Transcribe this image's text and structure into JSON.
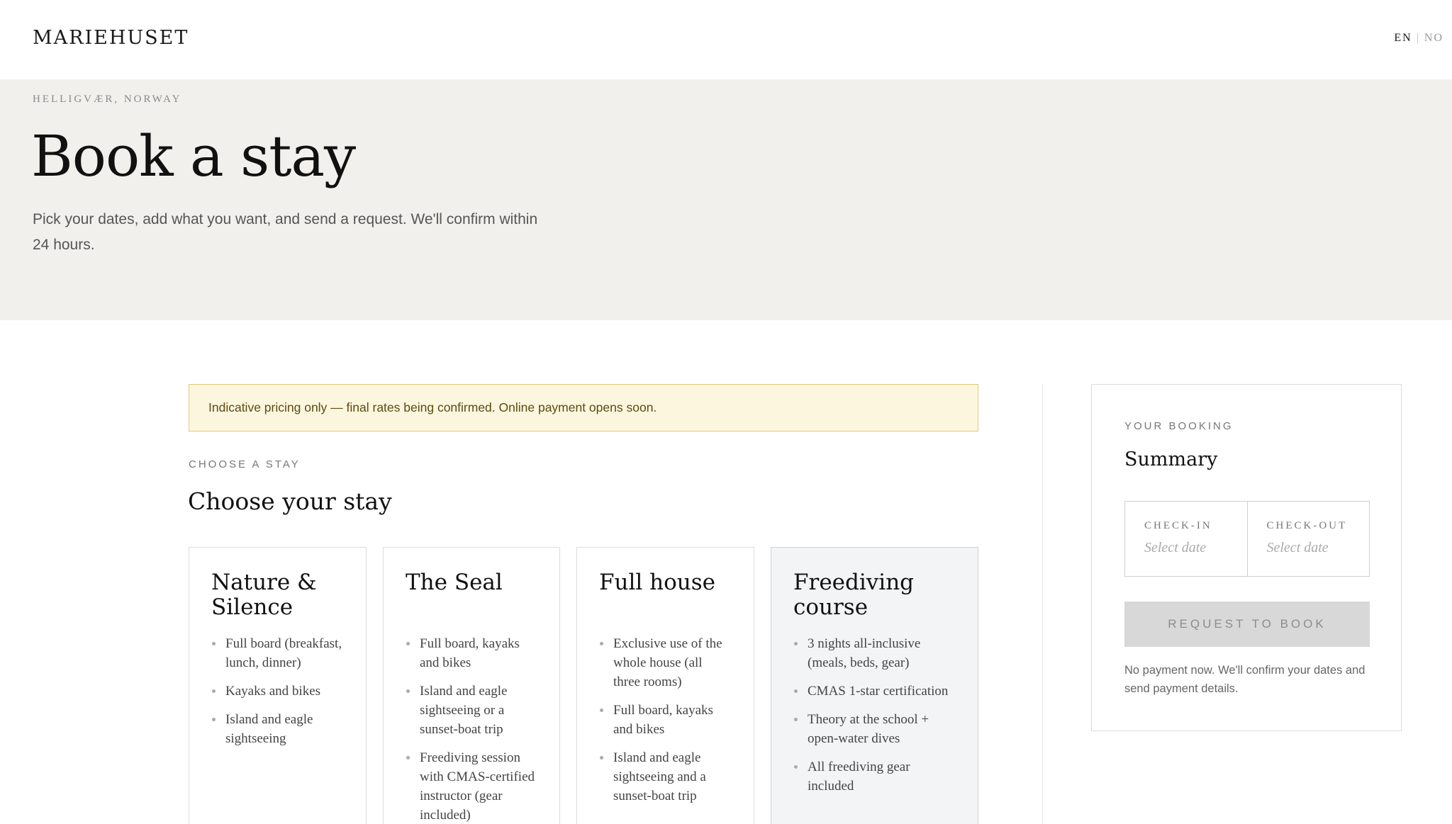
{
  "header": {
    "brand": "MARIEHUSET",
    "lang_en": "EN",
    "lang_separator": "|",
    "lang_no": "NO"
  },
  "hero": {
    "eyebrow": "HELLIGVÆR, NORWAY",
    "title": "Book a stay",
    "subtitle": "Pick your dates, add what you want, and send a request. We'll confirm within 24 hours."
  },
  "notice": {
    "text": "Indicative pricing only — final rates being confirmed. Online payment opens soon."
  },
  "stays": {
    "eyebrow": "CHOOSE A STAY",
    "title": "Choose your stay",
    "cards": [
      {
        "title": "Nature & Silence",
        "features": [
          "Full board (breakfast, lunch, dinner)",
          "Kayaks and bikes",
          "Island and eagle sightseeing"
        ]
      },
      {
        "title": "The Seal",
        "features": [
          "Full board, kayaks and bikes",
          "Island and eagle sightseeing or a sunset-boat trip",
          "Freediving session with CMAS-certified instructor (gear included)"
        ]
      },
      {
        "title": "Full house",
        "features": [
          "Exclusive use of the whole house (all three rooms)",
          "Full board, kayaks and bikes",
          "Island and eagle sightseeing and a sunset-boat trip"
        ]
      },
      {
        "title": "Freediving course",
        "features": [
          "3 nights all-inclusive (meals, beds, gear)",
          "CMAS 1-star certification",
          "Theory at the school + open-water dives",
          "All freediving gear included"
        ]
      }
    ]
  },
  "summary": {
    "eyebrow": "YOUR BOOKING",
    "title": "Summary",
    "checkin_label": "CHECK-IN",
    "checkin_value": "Select date",
    "checkout_label": "CHECK-OUT",
    "checkout_value": "Select date",
    "button_label": "REQUEST TO BOOK",
    "note": "No payment now. We'll confirm your dates and send payment details."
  }
}
